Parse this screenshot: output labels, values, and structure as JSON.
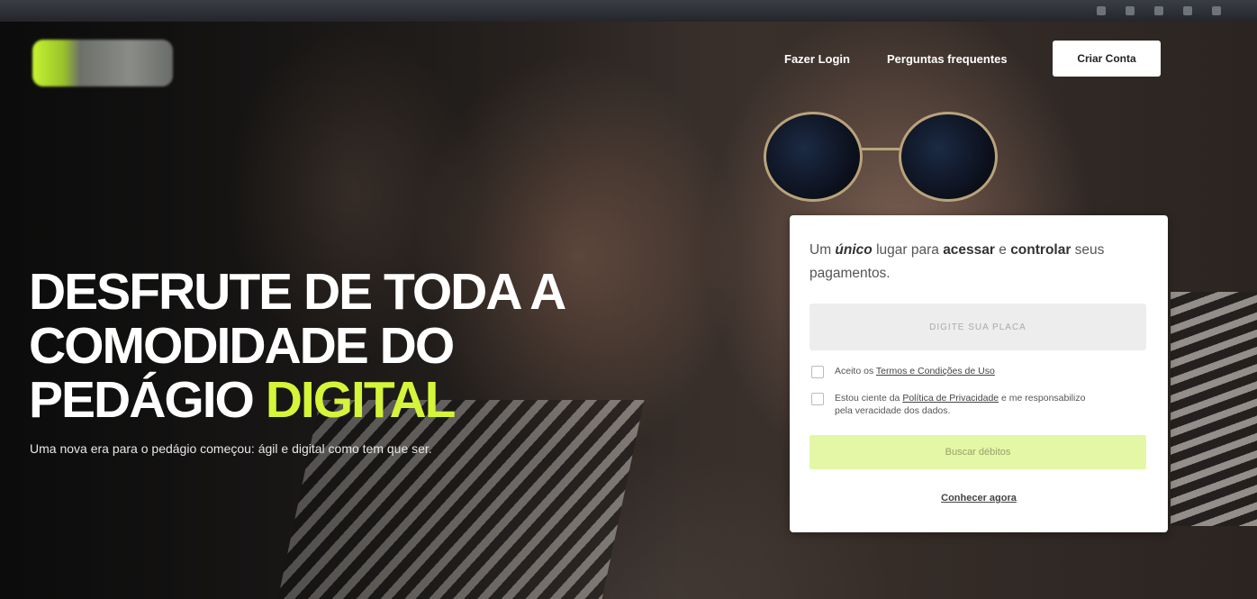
{
  "nav": {
    "login": "Fazer Login",
    "faq": "Perguntas frequentes",
    "create_account": "Criar Conta"
  },
  "hero": {
    "headline_line1": "DESFRUTE DE TODA A",
    "headline_line2": "COMODIDADE DO",
    "headline_line3_plain": "PEDÁGIO ",
    "headline_line3_accent": "DIGITAL",
    "subtitle": "Uma nova era para o pedágio começou: ágil e digital como tem que ser."
  },
  "card": {
    "title_part1": "Um ",
    "title_emph": "único",
    "title_part2": " lugar para ",
    "title_bold1": "acessar",
    "title_part3": " e ",
    "title_bold2": "controlar",
    "title_part4": " seus pagamentos.",
    "plate_placeholder": "DIGITE SUA PLACA",
    "terms_prefix": "Aceito os ",
    "terms_link": "Termos e Condições de Uso",
    "privacy_prefix": "Estou ciente da ",
    "privacy_link": "Política de Privacidade",
    "privacy_suffix": " e me responsabilizo pela veracidade dos dados.",
    "search_button": "Buscar débitos",
    "learn_more": "Conhecer agora"
  },
  "colors": {
    "accent": "#d4f53a",
    "button_bg": "#e4f7a6",
    "card_bg": "#ffffff"
  }
}
